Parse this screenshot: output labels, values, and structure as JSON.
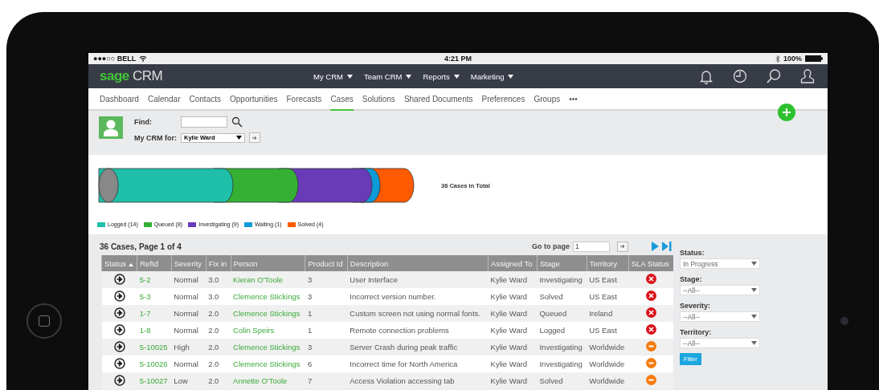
{
  "status_bar": {
    "carrier": "●●●○○ BELL",
    "time": "4:21 PM",
    "battery": "100%"
  },
  "logo": {
    "brand": "sage",
    "product": "CRM"
  },
  "top_menu": [
    {
      "label": "My CRM"
    },
    {
      "label": "Team CRM"
    },
    {
      "label": "Reports"
    },
    {
      "label": "Marketing"
    }
  ],
  "tabs": [
    {
      "label": "Dashboard",
      "selected": false
    },
    {
      "label": "Calendar",
      "selected": false
    },
    {
      "label": "Contacts",
      "selected": false
    },
    {
      "label": "Opportunities",
      "selected": false
    },
    {
      "label": "Forecasts",
      "selected": false
    },
    {
      "label": "Cases",
      "selected": true
    },
    {
      "label": "Solutions",
      "selected": false
    },
    {
      "label": "Shared Documents",
      "selected": false
    },
    {
      "label": "Preferences",
      "selected": false
    },
    {
      "label": "Groups",
      "selected": false
    },
    {
      "label": "•••",
      "selected": false
    }
  ],
  "find": {
    "label": "Find:"
  },
  "my_crm_for": {
    "label": "My CRM for:",
    "value": "Kylie Ward"
  },
  "chart": {
    "total_label": "36 Cases in Total",
    "legend": [
      {
        "label": "Logged (14)",
        "color": "#20bfa9"
      },
      {
        "label": "Queued (8)",
        "color": "#35b034"
      },
      {
        "label": "Investigating (9)",
        "color": "#6a3bb8"
      },
      {
        "label": "Waiting (1)",
        "color": "#0d9ad8"
      },
      {
        "label": "Solved (4)",
        "color": "#ff5a00"
      }
    ]
  },
  "list": {
    "title": "36 Cases, Page 1 of 4",
    "go_to_page": {
      "label": "Go to page",
      "value": "1"
    },
    "columns": [
      {
        "label": "Status",
        "sorted": true
      },
      {
        "label": "RefId",
        "sorted": false
      },
      {
        "label": "Severity",
        "sorted": false
      },
      {
        "label": "Fix in",
        "sorted": false
      },
      {
        "label": "Person",
        "sorted": false
      },
      {
        "label": "Product Id",
        "sorted": false
      },
      {
        "label": "Description",
        "sorted": false
      },
      {
        "label": "Assigned To",
        "sorted": false
      },
      {
        "label": "Stage",
        "sorted": false
      },
      {
        "label": "Territory",
        "sorted": false
      },
      {
        "label": "SLA Status",
        "sorted": false
      }
    ],
    "rows": [
      {
        "refid": "5-2",
        "severity": "Normal",
        "fix_in": "3.0",
        "person": "Kieran O'Toole",
        "product_id": "3",
        "description": "User Interface",
        "assigned_to": "Kylie Ward",
        "stage": "Investigating",
        "territory": "US East",
        "sla_breached": true
      },
      {
        "refid": "5-3",
        "severity": "Normal",
        "fix_in": "3.0",
        "person": "Clemence Stickings",
        "product_id": "3",
        "description": "Incorrect version number.",
        "assigned_to": "Kylie Ward",
        "stage": "Solved",
        "territory": "US East",
        "sla_breached": true
      },
      {
        "refid": "1-7",
        "severity": "Normal",
        "fix_in": "2.0",
        "person": "Clemence Stickings",
        "product_id": "1",
        "description": "Custom screen not using normal fonts.",
        "assigned_to": "Kylie Ward",
        "stage": "Queued",
        "territory": "Ireland",
        "sla_breached": true
      },
      {
        "refid": "1-8",
        "severity": "Normal",
        "fix_in": "2.0",
        "person": "Colin Speirs",
        "product_id": "1",
        "description": "Remote connection problems",
        "assigned_to": "Kylie Ward",
        "stage": "Logged",
        "territory": "US East",
        "sla_breached": true
      },
      {
        "refid": "5-10025",
        "severity": "High",
        "fix_in": "2.0",
        "person": "Clemence Stickings",
        "product_id": "3",
        "description": "Server Crash during peak traffic",
        "assigned_to": "Kylie Ward",
        "stage": "Investigating",
        "territory": "Worldwide",
        "sla_breached": false
      },
      {
        "refid": "5-10026",
        "severity": "Normal",
        "fix_in": "2.0",
        "person": "Clemence Stickings",
        "product_id": "6",
        "description": "Incorrect time for North America",
        "assigned_to": "Kylie Ward",
        "stage": "Investigating",
        "territory": "Worldwide",
        "sla_breached": false
      },
      {
        "refid": "5-10027",
        "severity": "Low",
        "fix_in": "2.0",
        "person": "Annette O'Toole",
        "product_id": "7",
        "description": "Access Violation accessing tab",
        "assigned_to": "Kylie Ward",
        "stage": "Solved",
        "territory": "Worldwide",
        "sla_breached": false
      }
    ]
  },
  "filters": [
    {
      "label": "Status:",
      "value": "In Progress"
    },
    {
      "label": "Stage:",
      "value": "--All--"
    },
    {
      "label": "Severity:",
      "value": "--All--"
    },
    {
      "label": "Territory:",
      "value": "--All--"
    }
  ],
  "filter_button": "Filter"
}
